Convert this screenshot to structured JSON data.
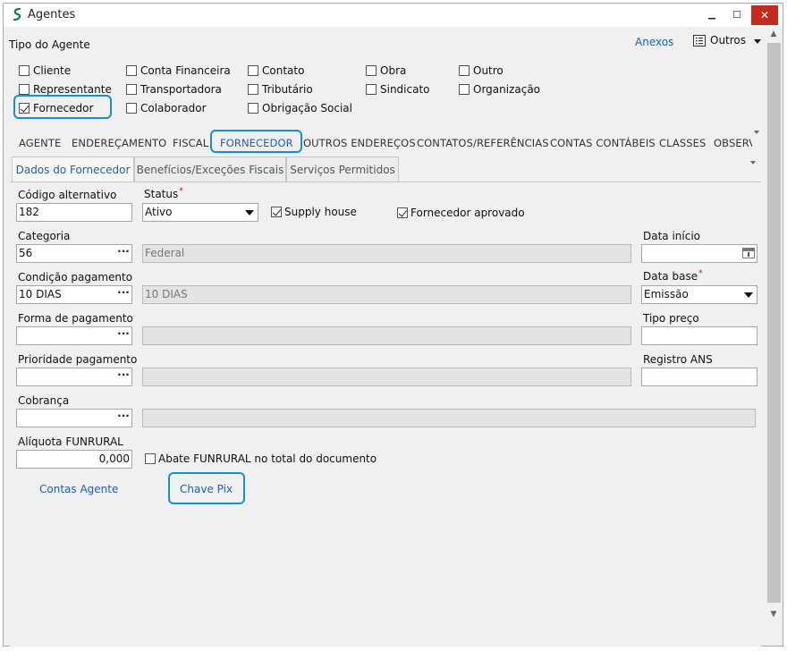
{
  "window": {
    "title": "Agentes",
    "minimize": "▁",
    "maximize": "☐",
    "close": "✕"
  },
  "header": {
    "tipo_label": "Tipo do Agente",
    "anexos": "Anexos",
    "outros": "Outros"
  },
  "agent_types": [
    {
      "label": "Cliente",
      "checked": false
    },
    {
      "label": "Representante",
      "checked": false
    },
    {
      "label": "Fornecedor",
      "checked": true
    },
    {
      "label": "Conta Financeira",
      "checked": false
    },
    {
      "label": "Transportadora",
      "checked": false
    },
    {
      "label": "Colaborador",
      "checked": false
    },
    {
      "label": "Contato",
      "checked": false
    },
    {
      "label": "Tributário",
      "checked": false
    },
    {
      "label": "Obrigação Social",
      "checked": false
    },
    {
      "label": "Obra",
      "checked": false
    },
    {
      "label": "Sindicato",
      "checked": false
    },
    {
      "label": "Outro",
      "checked": false
    },
    {
      "label": "Organização",
      "checked": false
    }
  ],
  "main_tabs": [
    "AGENTE",
    "ENDEREÇAMENTO",
    "FISCAL",
    "FORNECEDOR",
    "OUTROS ENDEREÇOS",
    "CONTATOS/REFERÊNCIAS",
    "CONTAS CONTÁBEIS",
    "CLASSES",
    "OBSERV"
  ],
  "active_main_tab": "FORNECEDOR",
  "sub_tabs": [
    "Dados do Fornecedor",
    "Benefícios/Exceções Fiscais",
    "Serviços Permitidos"
  ],
  "form": {
    "codigo_label": "Código alternativo",
    "codigo_value": "182",
    "status_label": "Status",
    "status_value": "Ativo",
    "supply_house_label": "Supply house",
    "supply_house_checked": true,
    "fornecedor_aprovado_label": "Fornecedor aprovado",
    "fornecedor_aprovado_checked": true,
    "categoria_label": "Categoria",
    "categoria_code": "56",
    "categoria_desc": "Federal",
    "data_inicio_label": "Data início",
    "data_inicio_value": "",
    "condicao_label": "Condição pagamento",
    "condicao_code": "10 DIAS",
    "condicao_desc": "10 DIAS",
    "data_base_label": "Data base",
    "data_base_value": "Emissão",
    "forma_label": "Forma de pagamento",
    "forma_code": "",
    "forma_desc": "",
    "tipo_preco_label": "Tipo preço",
    "tipo_preco_value": "",
    "prioridade_label": "Prioridade pagamento",
    "prioridade_code": "",
    "prioridade_desc": "",
    "registro_ans_label": "Registro ANS",
    "registro_ans_value": "",
    "cobranca_label": "Cobrança",
    "cobranca_code": "",
    "cobranca_desc": "",
    "aliquota_label": "Alíquota FUNRURAL",
    "aliquota_value": "0,000",
    "abate_label": "Abate FUNRURAL no total do documento",
    "abate_checked": false,
    "ellipsis": "···",
    "required_mark": "*"
  },
  "links": {
    "contas_agente": "Contas Agente",
    "chave_pix": "Chave Pix"
  },
  "colors": {
    "accent": "#1593c8",
    "link": "#1f5fb2",
    "required": "#d40000"
  }
}
